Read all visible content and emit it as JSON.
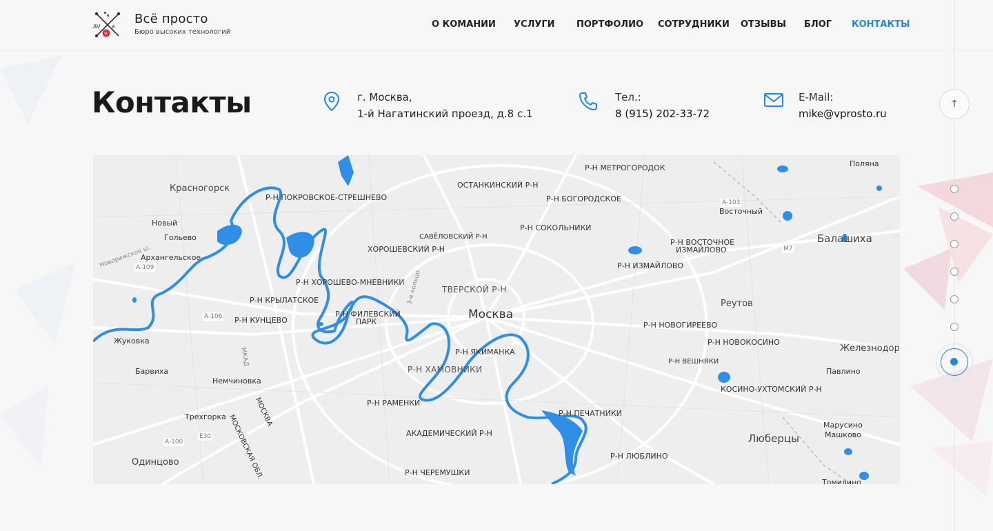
{
  "brand": {
    "title": "Всё просто",
    "subtitle": "Бюро высоких технологий",
    "logo_letters": "AV e"
  },
  "nav": {
    "items": [
      {
        "label": "О КОМАНИИ",
        "active": false
      },
      {
        "label": "УСЛУГИ",
        "active": false
      },
      {
        "label": "ПОРТФОЛИО",
        "active": false
      },
      {
        "label": "СОТРУДНИКИ",
        "active": false
      },
      {
        "label": "ОТЗЫВЫ",
        "active": false
      },
      {
        "label": "БЛОГ",
        "active": false
      },
      {
        "label": "КОНТАКТЫ",
        "active": true
      }
    ]
  },
  "page": {
    "title": "Контакты"
  },
  "contacts": {
    "address": {
      "line1": "г. Москва,",
      "line2": "1-й Нагатинский проезд, д.8 с.1",
      "icon": "map-pin-icon"
    },
    "phone": {
      "label": "Тел.:",
      "value": "8 (915) 202-33-72",
      "icon": "phone-icon"
    },
    "email": {
      "label": "E-Mail:",
      "value": "mike@vprosto.ru",
      "icon": "envelope-icon"
    }
  },
  "map": {
    "labels": [
      "Красногорск",
      "Р-Н ПОКРОВСКОЕ-СТРЕШНЕВО",
      "Новый",
      "Гольево",
      "Архангельское",
      "Р-Н ХОРОШЕВО-МНЕВНИКИ",
      "Р-Н КРЫЛАТСКОЕ",
      "Р-Н КУНЦЕВО",
      "Жуковка",
      "Барвиха",
      "Немчиновка",
      "Трехгорка",
      "Одинцово",
      "ОСТАНКИНСКИЙ Р-Н",
      "Р-Н БОГОРОДСКОЕ",
      "Р-Н СОКОЛЬНИКИ",
      "САВЁЛОВСКИЙ Р-Н",
      "ХОРОШЕВСКИЙ Р-Н",
      "ТВЕРСКОЙ Р-Н",
      "Москва",
      "Р-Н ФИЛЕВСКИЙ",
      "ПАРК",
      "Р-Н ЯКИМАНКА",
      "Р-Н ХАМОВНИКИ",
      "Р-Н РАМЕНКИ",
      "АКАДЕМИЧЕСКИЙ Р-Н",
      "Р-Н ЧЕРЕМУШКИ",
      "Р-Н ПЕЧАТНИКИ",
      "Р-Н ЛЮБЛИНО",
      "Р-Н МЕТРОГОРОДОК",
      "Р-Н ВОСТОЧНОЕ",
      "ИЗМАЙЛОВО",
      "Р-Н ИЗМАЙЛОВО",
      "Р-Н НОВОГИРЕЕВО",
      "Р-Н НОВОКОСИНО",
      "Р-Н ВЕШНЯКИ",
      "КОСИНО-УХТОМСКИЙ Р-Н",
      "Реутов",
      "Восточный",
      "Балашиха",
      "Железнодоро",
      "Павлино",
      "Марусино",
      "Машково",
      "Люберцы",
      "Поляна",
      "Томилино",
      "МОСКОВСКАЯ ОБЛ.",
      "МОСКВА",
      "МКАД",
      "A-109",
      "A-106",
      "A-100",
      "E30",
      "M7",
      "A-103",
      "3-е кольцо",
      "Новорижское ш."
    ],
    "water_color": "#2f8ee6",
    "land_color": "#eeeeee"
  },
  "side": {
    "up_label": "↑",
    "dots": 7,
    "active_dot": 7
  },
  "colors": {
    "accent": "#1e87e5"
  }
}
